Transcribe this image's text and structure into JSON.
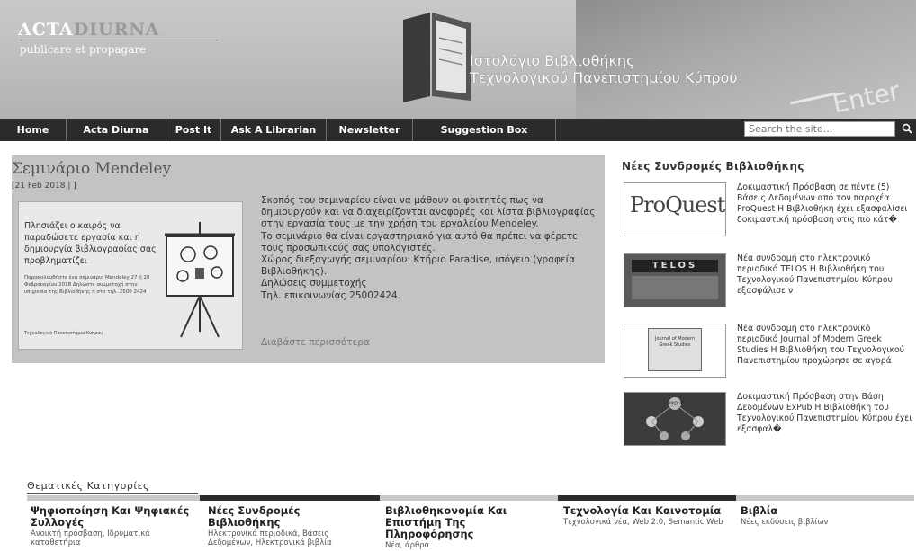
{
  "header": {
    "logo_acta": "ACTA",
    "logo_diurna": "DIURNA",
    "logo_tagline": "publicare et propagare",
    "site_title_line1": "Ιστολόγιο Βιβλιοθήκης",
    "site_title_line2": "Τεχνολογικού Πανεπιστημίου Κύπρου",
    "enter_text": "Enter"
  },
  "nav": {
    "items": [
      "Home",
      "Acta Diurna",
      "Post It",
      "Ask A Librarian",
      "Newsletter",
      "Suggestion Box"
    ],
    "search_placeholder": "Search the site..."
  },
  "post": {
    "title": "Σεμινάριο Mendeley",
    "date": "[21 Feb 2018 | ]",
    "image_text_1": "Πλησιάζει ο καιρός να παραδώσετε εργασία και η δημιουργία βιβλιογραφίας σας προβληματίζει",
    "image_text_2": "Παρακολουθήστε ένα σεμινάριο Mendeley 27 ή 28 Φεβρουαρίου 2018 Δηλώστε συμμετοχή στην υπηρεσία της Βιβλιοθήκης ή στο τηλ. 2500 2424",
    "image_text_3": "Τεχνολογικό Πανεπιστήμιο Κύπρου",
    "body": [
      "Σκοπός του σεμιναρίου είναι να μάθουν οι φοιτητές πως να δημιουργούν και να διαχειρίζονται αναφορές και λίστα βιβλιογραφίας στην εργασία τους με την χρήση του εργαλείου Mendeley.",
      "Το σεμινάριο θα είναι εργαστηριακό για αυτό θα πρέπει να φέρετε τους προσωπικούς σας υπολογιστές.",
      "Χώρος διεξαγωγής σεμιναρίου: Κτήριο Paradise, ισόγειο (γραφεία Βιβλιοθήκης).",
      "Δηλώσεις συμμετοχής",
      "Τηλ. επικοινωνίας 25002424."
    ],
    "read_more": "Διαβάστε περισσότερα"
  },
  "sidebar": {
    "title": "Νέες Συνδρομές Βιβλιοθήκης",
    "items": [
      {
        "thumb": "ProQuest.",
        "text": "Δοκιμαστική Πρόσβαση σε πέντε (5) Βάσεις Δεδομένων από τον παροχέα ProQuest Η Βιβλιοθήκη έχει εξασφαλίσει δοκιμαστική πρόσβαση στις πιο κάτ�"
      },
      {
        "thumb": "TELOS",
        "text": "Νέα συνδρομή στο ηλεκτρονικό περιοδικό TELOS Η Βιβλιοθήκη του Τεχνολογικού Πανεπιστημίου Κύπρου εξασφάλισε ν"
      },
      {
        "thumb": "Journal of Modern Greek Studies",
        "text": "Νέα συνδρομή στο ηλεκτρονικό περιοδικό Journal of Modern Greek Studies Η Βιβλιοθήκη του Τεχνολογικού Πανεπιστημίου προχώρησε σε αγορά"
      },
      {
        "thumb": "expub",
        "text": "Δοκιμαστική Πρόσβαση στην Βάση Δεδομένων ExPub Η Βιβλιοθήκη του Τεχνολογικού Πανεπιστημίου Κύπρου έχει εξασφαλ�"
      }
    ]
  },
  "categories": {
    "title": "Θεματικές Κατηγορίες",
    "items": [
      {
        "heading": "Ψηφιοποίηση Και Ψηφιακές Συλλογές",
        "desc": "Ανοικτή πρόσβαση, Ιδρυματικά καταθετήρια"
      },
      {
        "heading": "Νέες Συνδρομές Βιβλιοθήκης",
        "desc": "Ηλεκτρονικά περιοδικά, Βάσεις Δεδομένων, Ηλεκτρονικά βιβλία"
      },
      {
        "heading": "Βιβλιοθηκονομία Και Επιστήμη Της Πληροφόρησης",
        "desc": "Νέα, άρθρα"
      },
      {
        "heading": "Τεχνολογία Και Καινοτομία",
        "desc": "Τεχνολογικά νέα, Web 2.0, Semantic Web"
      },
      {
        "heading": "Βιβλία",
        "desc": "Νέες εκδόσεις βιβλίων"
      }
    ]
  },
  "colors": {
    "nav_bg": "#2b2b2b",
    "post_bg": "#c3c3c3",
    "category_bars": [
      "#c9c9c9",
      "#2b2b2b",
      "#c9c9c9",
      "#2b2b2b",
      "#c9c9c9"
    ]
  }
}
